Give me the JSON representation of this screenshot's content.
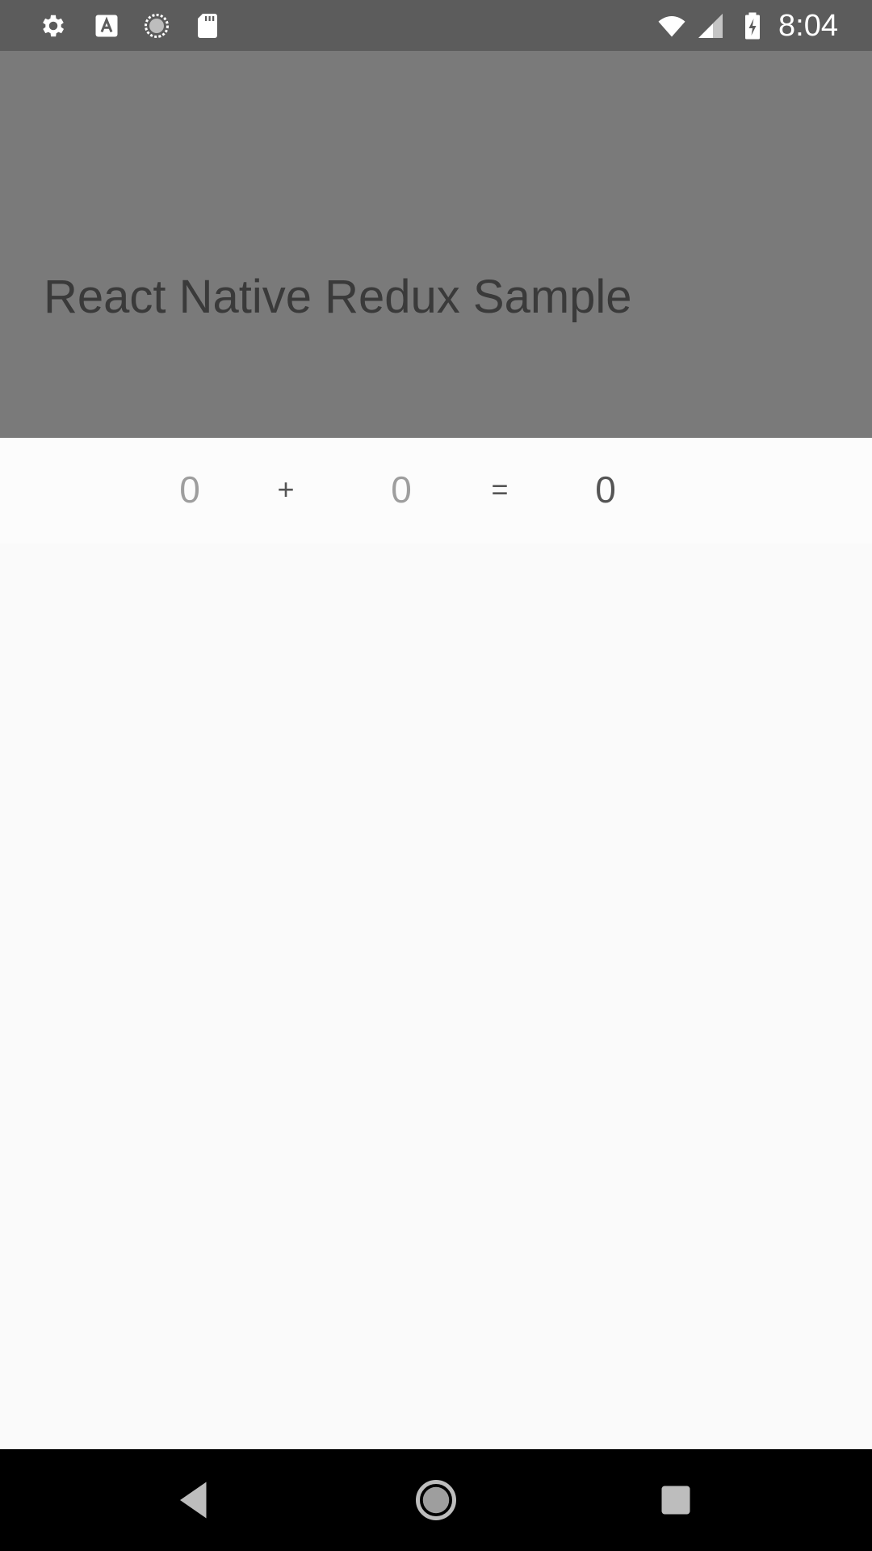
{
  "status_bar": {
    "time": "8:04",
    "left_icons": [
      "gear-icon",
      "font-a-icon",
      "sync-circle-icon",
      "sd-card-icon"
    ],
    "right_icons": [
      "wifi-icon",
      "signal-icon",
      "battery-charging-icon"
    ]
  },
  "header": {
    "title": "React Native Redux Sample"
  },
  "equation": {
    "operand_a": "0",
    "plus": "+",
    "operand_b": "0",
    "equals": "=",
    "result": "0"
  },
  "nav_bar": {
    "buttons": [
      "back-icon",
      "home-icon",
      "recents-icon"
    ]
  },
  "colors": {
    "status_bar": "#5c5c5c",
    "header": "#7a7a7a",
    "title_text": "#3a3a3a",
    "background": "#fafafa",
    "nav_bar": "#000000"
  }
}
